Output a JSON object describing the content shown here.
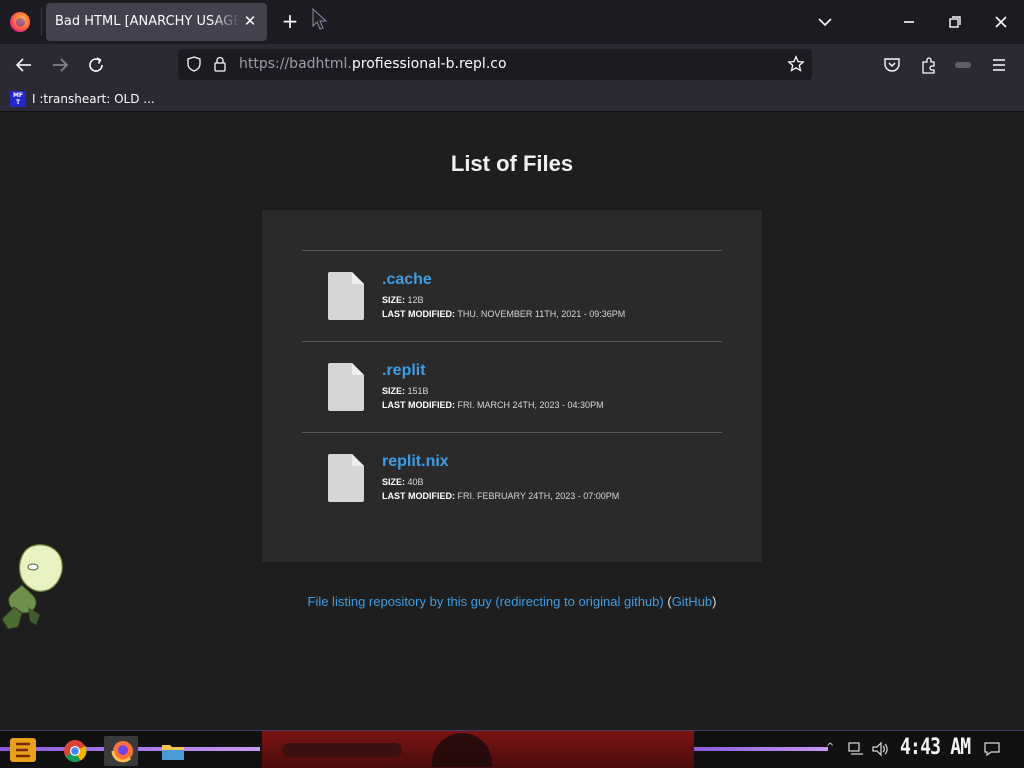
{
  "browser": {
    "tab": {
      "title": "Bad HTML [ANARCHY USAGE ONLY]"
    },
    "url": {
      "prefix": "https://badhtml.",
      "domain": "profiessional-b.repl.co"
    },
    "bookmarks": [
      {
        "favicon_text": "MF T",
        "label": "I :transheart: OLD ..."
      }
    ]
  },
  "page": {
    "title": "List of Files",
    "size_label": "Size:",
    "modified_label": "Last Modified:",
    "files": [
      {
        "name": ".cache",
        "size": "12b",
        "modified": "Thu. November 11th, 2021 - 09:36pm"
      },
      {
        "name": ".replit",
        "size": "151b",
        "modified": "Fri. March 24th, 2023 - 04:30pm"
      },
      {
        "name": "replit.nix",
        "size": "40b",
        "modified": "Fri. February 24th, 2023 - 07:00pm"
      }
    ],
    "footer": {
      "link_text": "File listing repository by this guy (redirecting to original github)",
      "open": "(",
      "github": "GitHub",
      "close": ")"
    }
  },
  "taskbar": {
    "clock": "4:43 AM"
  },
  "colors": {
    "link": "#3d9ee6",
    "panel": "#2a2a2a",
    "background": "#1e1e1e",
    "tab_active": "#42414d"
  }
}
